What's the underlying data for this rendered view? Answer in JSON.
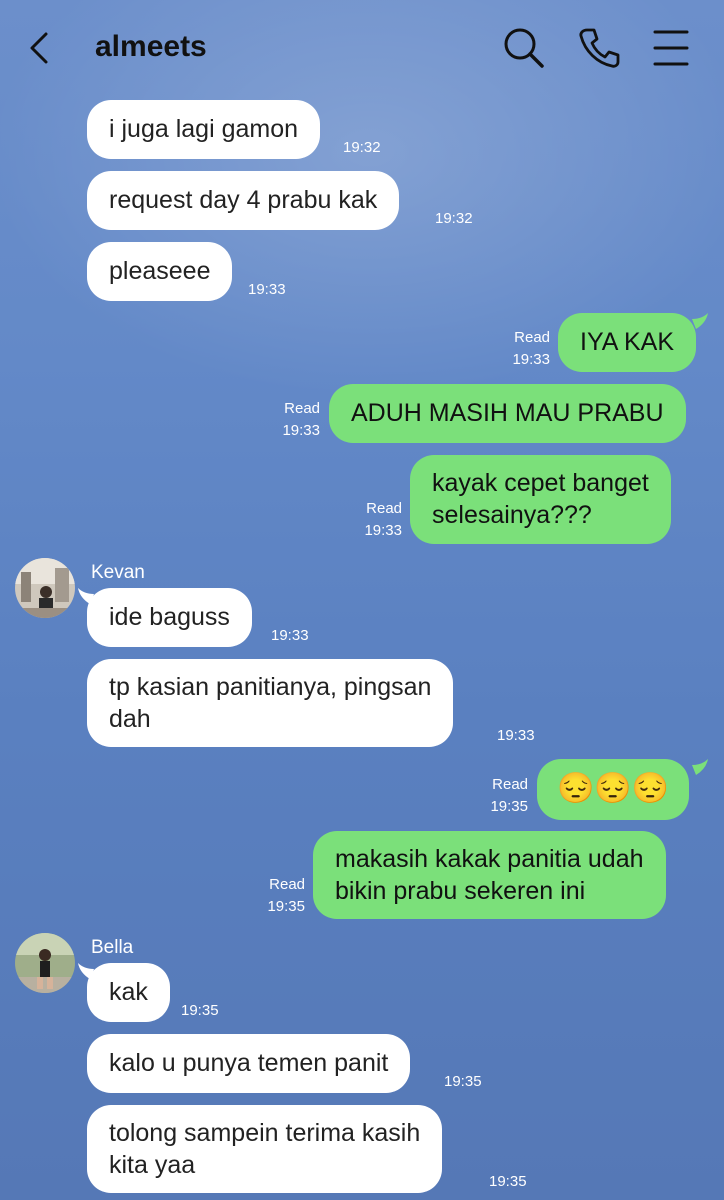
{
  "header": {
    "title": "almeets"
  },
  "icons": {
    "back": "chevron-left-icon",
    "search": "search-icon",
    "call": "phone-icon",
    "menu": "menu-icon"
  },
  "colors": {
    "background": "#6389c8",
    "incoming_bubble": "#ffffff",
    "outgoing_bubble": "#7be07a"
  },
  "messages": [
    {
      "side": "in",
      "text": "i juga lagi gamon",
      "time": "19:32"
    },
    {
      "side": "in",
      "text": "request day 4 prabu kak",
      "time": "19:32"
    },
    {
      "side": "in",
      "text": "pleaseee",
      "time": "19:33"
    },
    {
      "side": "out",
      "text": "IYA KAK",
      "status": "Read",
      "time": "19:33"
    },
    {
      "side": "out",
      "text": "ADUH MASIH MAU PRABU",
      "status": "Read",
      "time": "19:33"
    },
    {
      "side": "out",
      "line1": "kayak cepet banget",
      "line2": "selesainya???",
      "status": "Read",
      "time": "19:33"
    },
    {
      "side": "in",
      "sender": "Kevan",
      "text": "ide baguss",
      "time": "19:33"
    },
    {
      "side": "in",
      "line1": "tp kasian panitianya, pingsan",
      "line2": "dah",
      "time": "19:33"
    },
    {
      "side": "out",
      "text": "😔😔😔",
      "status": "Read",
      "time": "19:35"
    },
    {
      "side": "out",
      "line1": "makasih kakak panitia udah",
      "line2": "bikin prabu sekeren ini",
      "status": "Read",
      "time": "19:35"
    },
    {
      "side": "in",
      "sender": "Bella",
      "text": "kak",
      "time": "19:35"
    },
    {
      "side": "in",
      "text": "kalo u punya temen panit",
      "time": "19:35"
    },
    {
      "side": "in",
      "line1": "tolong sampein terima kasih",
      "line2": "kita yaa",
      "time": "19:35"
    }
  ]
}
